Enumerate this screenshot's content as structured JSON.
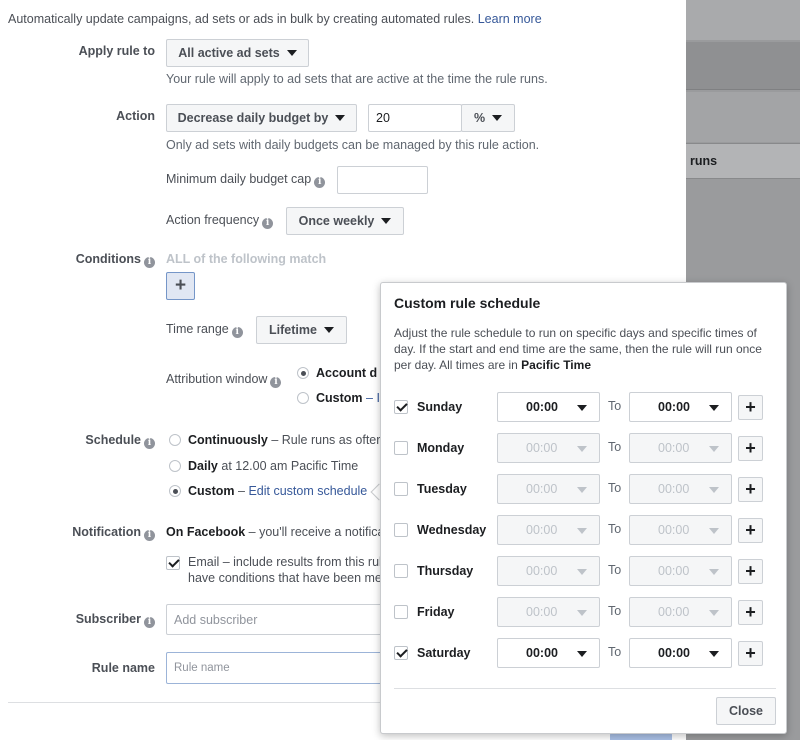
{
  "background": {
    "runs_label": "runs"
  },
  "header": {
    "description": "Automatically update campaigns, ad sets or ads in bulk by creating automated rules.",
    "learn_more": "Learn more"
  },
  "apply_rule": {
    "label": "Apply rule to",
    "value": "All active ad sets",
    "hint": "Your rule will apply to ad sets that are active at the time the rule runs."
  },
  "action": {
    "label": "Action",
    "value": "Decrease daily budget by",
    "amount": "20",
    "unit": "%",
    "hint": "Only ad sets with daily budgets can be managed by this rule action.",
    "min_cap_label": "Minimum daily budget cap",
    "min_cap_value": "",
    "frequency_label": "Action frequency",
    "frequency_value": "Once weekly"
  },
  "conditions": {
    "label": "Conditions",
    "match_text": "ALL of the following match",
    "add_symbol": "+",
    "time_range_label": "Time range",
    "time_range_value": "Lifetime",
    "attribution_label": "Attribution window",
    "attribution_options": [
      "Account d",
      "Custom"
    ],
    "attribution_custom_suffix": "– I"
  },
  "schedule": {
    "label": "Schedule",
    "continuously": "Continuously",
    "continuously_desc": "– Rule runs as ofter",
    "daily": "Daily",
    "daily_desc": "at 12.00 am Pacific Time",
    "custom": "Custom",
    "custom_dash": "–",
    "custom_link": "Edit custom schedule"
  },
  "notification": {
    "label": "Notification",
    "on_facebook": "On Facebook",
    "on_facebook_desc": "– you'll receive a notifica",
    "email_line1": "Email – include results from this rule",
    "email_line2": "have conditions that have been met"
  },
  "subscriber": {
    "label": "Subscriber",
    "placeholder": "Add subscriber"
  },
  "rule_name": {
    "label": "Rule name",
    "placeholder": "Rule name"
  },
  "popup": {
    "title": "Custom rule schedule",
    "desc_prefix": "Adjust the rule schedule to run on specific days and specific times of day. If the start and end time are the same, then the rule will run once per day. All times are in ",
    "desc_timezone": "Pacific Time",
    "to_label": "To",
    "plus_symbol": "+",
    "days": [
      {
        "name": "Sunday",
        "checked": true,
        "start": "00:00",
        "end": "00:00"
      },
      {
        "name": "Monday",
        "checked": false,
        "start": "00:00",
        "end": "00:00"
      },
      {
        "name": "Tuesday",
        "checked": false,
        "start": "00:00",
        "end": "00:00"
      },
      {
        "name": "Wednesday",
        "checked": false,
        "start": "00:00",
        "end": "00:00"
      },
      {
        "name": "Thursday",
        "checked": false,
        "start": "00:00",
        "end": "00:00"
      },
      {
        "name": "Friday",
        "checked": false,
        "start": "00:00",
        "end": "00:00"
      },
      {
        "name": "Saturday",
        "checked": true,
        "start": "00:00",
        "end": "00:00"
      }
    ],
    "close_label": "Close"
  }
}
